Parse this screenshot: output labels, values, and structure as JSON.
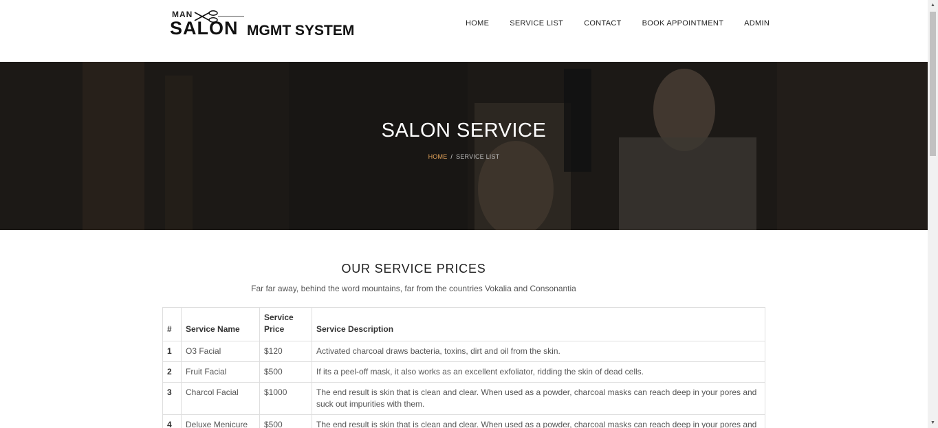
{
  "header": {
    "logo": {
      "small": "MAN",
      "main": "SALON",
      "suffix": "MGMT SYSTEM"
    },
    "nav": [
      "HOME",
      "SERVICE LIST",
      "CONTACT",
      "BOOK APPOINTMENT",
      "ADMIN"
    ]
  },
  "hero": {
    "title": "SALON SERVICE",
    "breadcrumb": {
      "home": "HOME",
      "separator": "/",
      "current": "SERVICE LIST"
    }
  },
  "section": {
    "title": "OUR SERVICE PRICES",
    "subtitle": "Far far away, behind the word mountains, far from the countries Vokalia and Consonantia"
  },
  "table": {
    "headers": [
      "#",
      "Service Name",
      "Service Price",
      "Service Description"
    ],
    "rows": [
      {
        "num": "1",
        "name": "O3 Facial",
        "price": "$120",
        "desc": "Activated charcoal draws bacteria, toxins, dirt and oil from the skin."
      },
      {
        "num": "2",
        "name": "Fruit Facial",
        "price": "$500",
        "desc": "If its a peel-off mask, it also works as an excellent exfoliator, ridding the skin of dead cells."
      },
      {
        "num": "3",
        "name": "Charcol Facial",
        "price": "$1000",
        "desc": "The end result is skin that is clean and clear. When used as a powder, charcoal masks can reach deep in your pores and suck out impurities with them."
      },
      {
        "num": "4",
        "name": "Deluxe Menicure",
        "price": "$500",
        "desc": "The end result is skin that is clean and clear. When used as a powder, charcoal masks can reach deep in your pores and suck out impurities with them."
      }
    ]
  },
  "colors": {
    "accent": "#e3a45a",
    "hero_bg": "#2b2723"
  }
}
